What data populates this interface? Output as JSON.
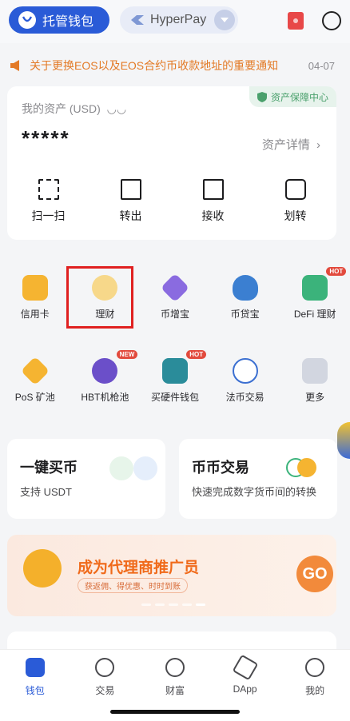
{
  "topbar": {
    "wallet_label": "托管钱包",
    "network_label": "HyperPay"
  },
  "notice": {
    "text": "关于更换EOS以及EOS合约币收款地址的重要通知",
    "date": "04-07"
  },
  "asset": {
    "label": "我的资产 (USD)",
    "badge": "资产保障中心",
    "amount": "*****",
    "detail": "资产详情",
    "actions": [
      "扫一扫",
      "转出",
      "接收",
      "划转"
    ]
  },
  "grid": {
    "row1": [
      {
        "label": "信用卡",
        "tag": ""
      },
      {
        "label": "理财",
        "tag": ""
      },
      {
        "label": "币增宝",
        "tag": ""
      },
      {
        "label": "币贷宝",
        "tag": ""
      },
      {
        "label": "DeFi 理财",
        "tag": "HOT"
      }
    ],
    "row2": [
      {
        "label": "PoS 矿池",
        "tag": ""
      },
      {
        "label": "HBT机枪池",
        "tag": "NEW"
      },
      {
        "label": "买硬件钱包",
        "tag": "HOT"
      },
      {
        "label": "法币交易",
        "tag": ""
      },
      {
        "label": "更多",
        "tag": ""
      }
    ]
  },
  "buy": {
    "left": {
      "title": "一键买币",
      "sub": "支持 USDT"
    },
    "right": {
      "title": "币币交易",
      "sub": "快速完成数字货币间的转换"
    }
  },
  "banner": {
    "title": "成为代理商推广员",
    "sub": "获返佣、得优惠、时时到账",
    "go": "GO"
  },
  "tabs": [
    "钱包",
    "交易",
    "财富",
    "DApp",
    "我的"
  ],
  "colors": {
    "accent": "#2a5bd7",
    "notice": "#e37a26",
    "highlight": "#e02020"
  }
}
